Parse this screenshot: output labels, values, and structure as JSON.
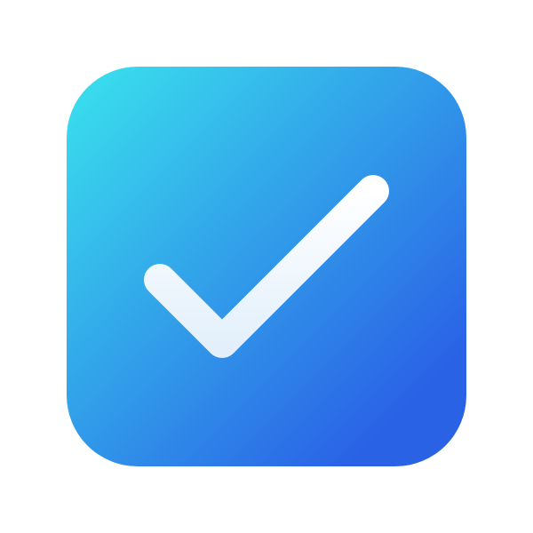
{
  "icon": {
    "name": "checkmark-icon",
    "shape": "rounded-square",
    "colors": {
      "gradient_start": "#3ae3ee",
      "gradient_end": "#2a62e6",
      "check_start": "#ffffff",
      "check_end": "#e3f0fb",
      "page_background": "#ffffff"
    }
  }
}
